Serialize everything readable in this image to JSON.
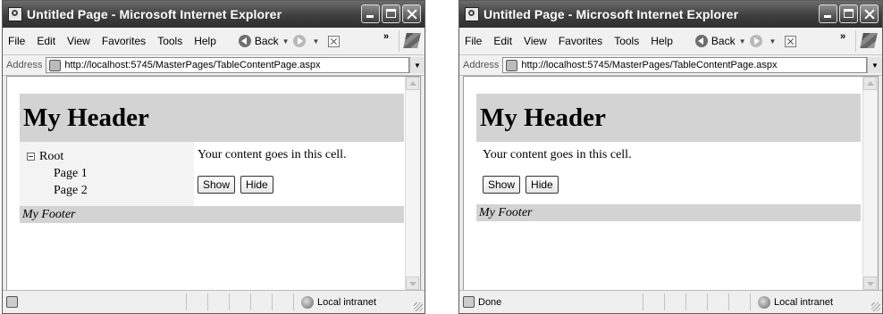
{
  "windows": [
    {
      "title": "Untitled Page - Microsoft Internet Explorer",
      "menu": [
        "File",
        "Edit",
        "View",
        "Favorites",
        "Tools",
        "Help"
      ],
      "back_label": "Back",
      "overflow_chevron": "»",
      "address_label": "Address",
      "url": "http://localhost:5745/MasterPages/TableContentPage.aspx",
      "page": {
        "header": "My Header",
        "tree": {
          "root": "Root",
          "children": [
            "Page 1",
            "Page 2"
          ]
        },
        "content": "Your content goes in this cell.",
        "buttons": [
          "Show",
          "Hide"
        ],
        "footer": "My Footer"
      },
      "status": {
        "text": "",
        "zone": "Local intranet"
      }
    },
    {
      "title": "Untitled Page - Microsoft Internet Explorer",
      "menu": [
        "File",
        "Edit",
        "View",
        "Favorites",
        "Tools",
        "Help"
      ],
      "back_label": "Back",
      "overflow_chevron": "»",
      "address_label": "Address",
      "url": "http://localhost:5745/MasterPages/TableContentPage.aspx",
      "page": {
        "header": "My Header",
        "content": "Your content goes in this cell.",
        "buttons": [
          "Show",
          "Hide"
        ],
        "footer": "My Footer"
      },
      "status": {
        "text": "Done",
        "zone": "Local intranet"
      }
    }
  ]
}
